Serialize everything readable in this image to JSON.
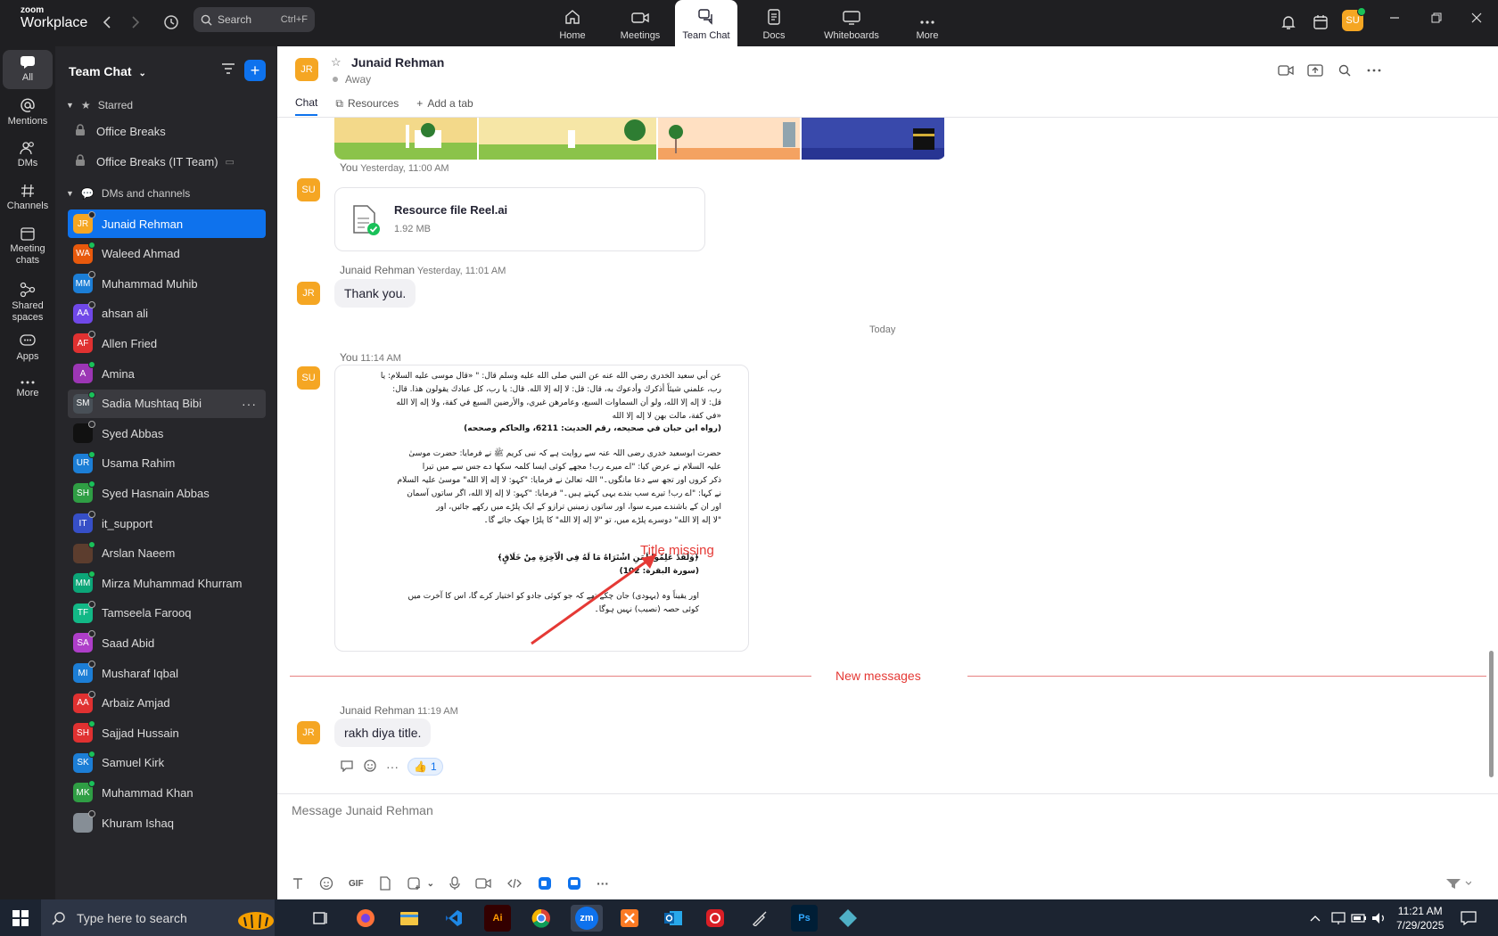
{
  "app": {
    "brand_small": "zoom",
    "brand": "Workplace"
  },
  "search": {
    "label": "Search",
    "shortcut": "Ctrl+F"
  },
  "nav_tabs": [
    {
      "label": "Home",
      "icon": "home-icon"
    },
    {
      "label": "Meetings",
      "icon": "video-icon"
    },
    {
      "label": "Team Chat",
      "icon": "chat-icon",
      "active": true
    },
    {
      "label": "Docs",
      "icon": "docs-icon"
    },
    {
      "label": "Whiteboards",
      "icon": "whiteboard-icon"
    },
    {
      "label": "More",
      "icon": "more-icon"
    }
  ],
  "user_avatar": "SU",
  "rail": [
    {
      "label": "All"
    },
    {
      "label": "Mentions"
    },
    {
      "label": "DMs"
    },
    {
      "label": "Channels"
    },
    {
      "label": "Meeting chats"
    },
    {
      "label": "Shared spaces"
    },
    {
      "label": "Apps"
    },
    {
      "label": "More"
    }
  ],
  "sidebar": {
    "title": "Team Chat",
    "starred_label": "Starred",
    "starred": [
      "Office Breaks",
      "Office Breaks (IT Team)"
    ],
    "dms_label": "DMs and channels",
    "dms": [
      {
        "initials": "JR",
        "name": "Junaid Rehman",
        "color": "#f5a623",
        "status": "off"
      },
      {
        "initials": "WA",
        "name": "Waleed Ahmad",
        "color": "#e8590c",
        "status": "on"
      },
      {
        "initials": "MM",
        "name": "Muhammad Muhib",
        "color": "#1c7ed6",
        "status": "off"
      },
      {
        "initials": "AA",
        "name": "ahsan ali",
        "color": "#7048e8",
        "status": "off"
      },
      {
        "initials": "AF",
        "name": "Allen Fried",
        "color": "#e03131",
        "status": "off"
      },
      {
        "initials": "A",
        "name": "Amina",
        "color": "#9c36b5",
        "status": "on"
      },
      {
        "initials": "SM",
        "name": "Sadia Mushtaq Bibi",
        "color": "#495057",
        "status": "on"
      },
      {
        "initials": "",
        "name": "Syed Abbas",
        "color": "#111111",
        "status": "off"
      },
      {
        "initials": "UR",
        "name": "Usama Rahim",
        "color": "#1c7ed6",
        "status": "on"
      },
      {
        "initials": "SH",
        "name": "Syed Hasnain Abbas",
        "color": "#2f9e44",
        "status": "on"
      },
      {
        "initials": "IT",
        "name": "it_support",
        "color": "#364fc7",
        "status": "off"
      },
      {
        "initials": "",
        "name": "Arslan Naeem",
        "color": "#5c3d2e",
        "status": "on"
      },
      {
        "initials": "MM",
        "name": "Mirza Muhammad Khurram",
        "color": "#0ca678",
        "status": "on"
      },
      {
        "initials": "TF",
        "name": "Tamseela Farooq",
        "color": "#12b886",
        "status": "off"
      },
      {
        "initials": "SA",
        "name": "Saad Abid",
        "color": "#ae3ec9",
        "status": "off"
      },
      {
        "initials": "MI",
        "name": "Musharaf Iqbal",
        "color": "#1c7ed6",
        "status": "off"
      },
      {
        "initials": "AA",
        "name": "Arbaiz Amjad",
        "color": "#e03131",
        "status": "off"
      },
      {
        "initials": "SH",
        "name": "Sajjad Hussain",
        "color": "#e03131",
        "status": "on"
      },
      {
        "initials": "SK",
        "name": "Samuel Kirk",
        "color": "#1c7ed6",
        "status": "on"
      },
      {
        "initials": "MK",
        "name": "Muhammad Khan",
        "color": "#2f9e44",
        "status": "on"
      },
      {
        "initials": "",
        "name": "Khuram Ishaq",
        "color": "#868e96",
        "status": "off"
      }
    ]
  },
  "chat": {
    "contact_initials": "JR",
    "contact_name": "Junaid Rehman",
    "status": "Away",
    "tabs": [
      "Chat",
      "Resources",
      "Add a tab"
    ],
    "messages": {
      "file_sender": "You",
      "file_time": "Yesterday, 11:00 AM",
      "file_name": "Resource file Reel.ai",
      "file_size": "1.92 MB",
      "thanks_sender": "Junaid Rehman",
      "thanks_time": "Yesterday, 11:01 AM",
      "thanks_text": "Thank you.",
      "divider": "Today",
      "doc_sender": "You",
      "doc_time": "11:14 AM",
      "annotation": "Title missing",
      "new_messages": "New messages",
      "reply_sender": "Junaid Rehman",
      "reply_time": "11:19 AM",
      "reply_text": "rakh diya title.",
      "reaction_count": "1"
    },
    "doc_lines": [
      "عن أبي سعيد الخدري رضي الله عنه عن النبي صلى الله عليه وسلم قال: \" «قال موسى عليه السلام: يا",
      "رب، علمني شيئاً أذكرك وأدعوك به، قال: قل: لا إله إلا الله. قال: يا رب، كل عبادك يقولون هذا. قال:",
      "قل: لا إله إلا الله، ولو أن السماوات السبع، وعامرهن غيري، والأرضين السبع في كفة، ولا إله إلا الله",
      "«في كفة، مالت بهن لا إله إلا الله",
      "(رواه ابن حبان في صحيحه، رقم الحديث: 6211، والحاكم وصححه)",
      "حضرت ابوسعید خدری رضی اللہ عنہ سے روایت ہے کہ نبی کریم ﷺ نے فرمایا: حضرت موسیٰ",
      "علیہ السلام نے عرض کیا: \"اے میرے رب! مجھے کوئی ایسا کلمہ سکھا دے جس سے میں تیرا",
      "ذکر کروں اور تجھ سے دعا مانگوں۔\" اللہ تعالیٰ نے فرمایا: \"کہو: لا إله إلا الله\" موسیٰ علیہ السلام",
      "نے کہا: \"اے رب! تیرے سب بندے یہی کہتے ہیں۔\" فرمایا: \"کہو: لا إله إلا الله، اگر ساتوں آسمان",
      "اور ان کے باشندے میرے سوا، اور ساتوں زمینیں ترازو کے ایک پلڑے میں رکھے جائیں، اور",
      "\"لا إله إلا الله\" دوسرے پلڑے میں، تو \"لا إله إلا الله\" کا پلڑا جھک جائے گا۔",
      "﴿وَلَقَدْ عَلِمُوا لَمَنِ اشْتَرَاهُ مَا لَهُ فِي الْآخِرَةِ مِنْ خَلَاقٍ﴾",
      "(سورة البقرة: 102)",
      "اور یقیناً وہ (یہودی) جان چکے تھے کہ جو کوئی جادو کو اختیار کرے گا، اس کا آخرت میں",
      "کوئی حصہ (نصیب) نہیں ہوگا۔"
    ],
    "composer_placeholder": "Message Junaid Rehman",
    "gif_label": "GIF"
  },
  "taskbar": {
    "search_placeholder": "Type here to search",
    "time": "11:21 AM",
    "date": "7/29/2025",
    "apps": [
      "Ai",
      "zm",
      "Ps"
    ]
  }
}
